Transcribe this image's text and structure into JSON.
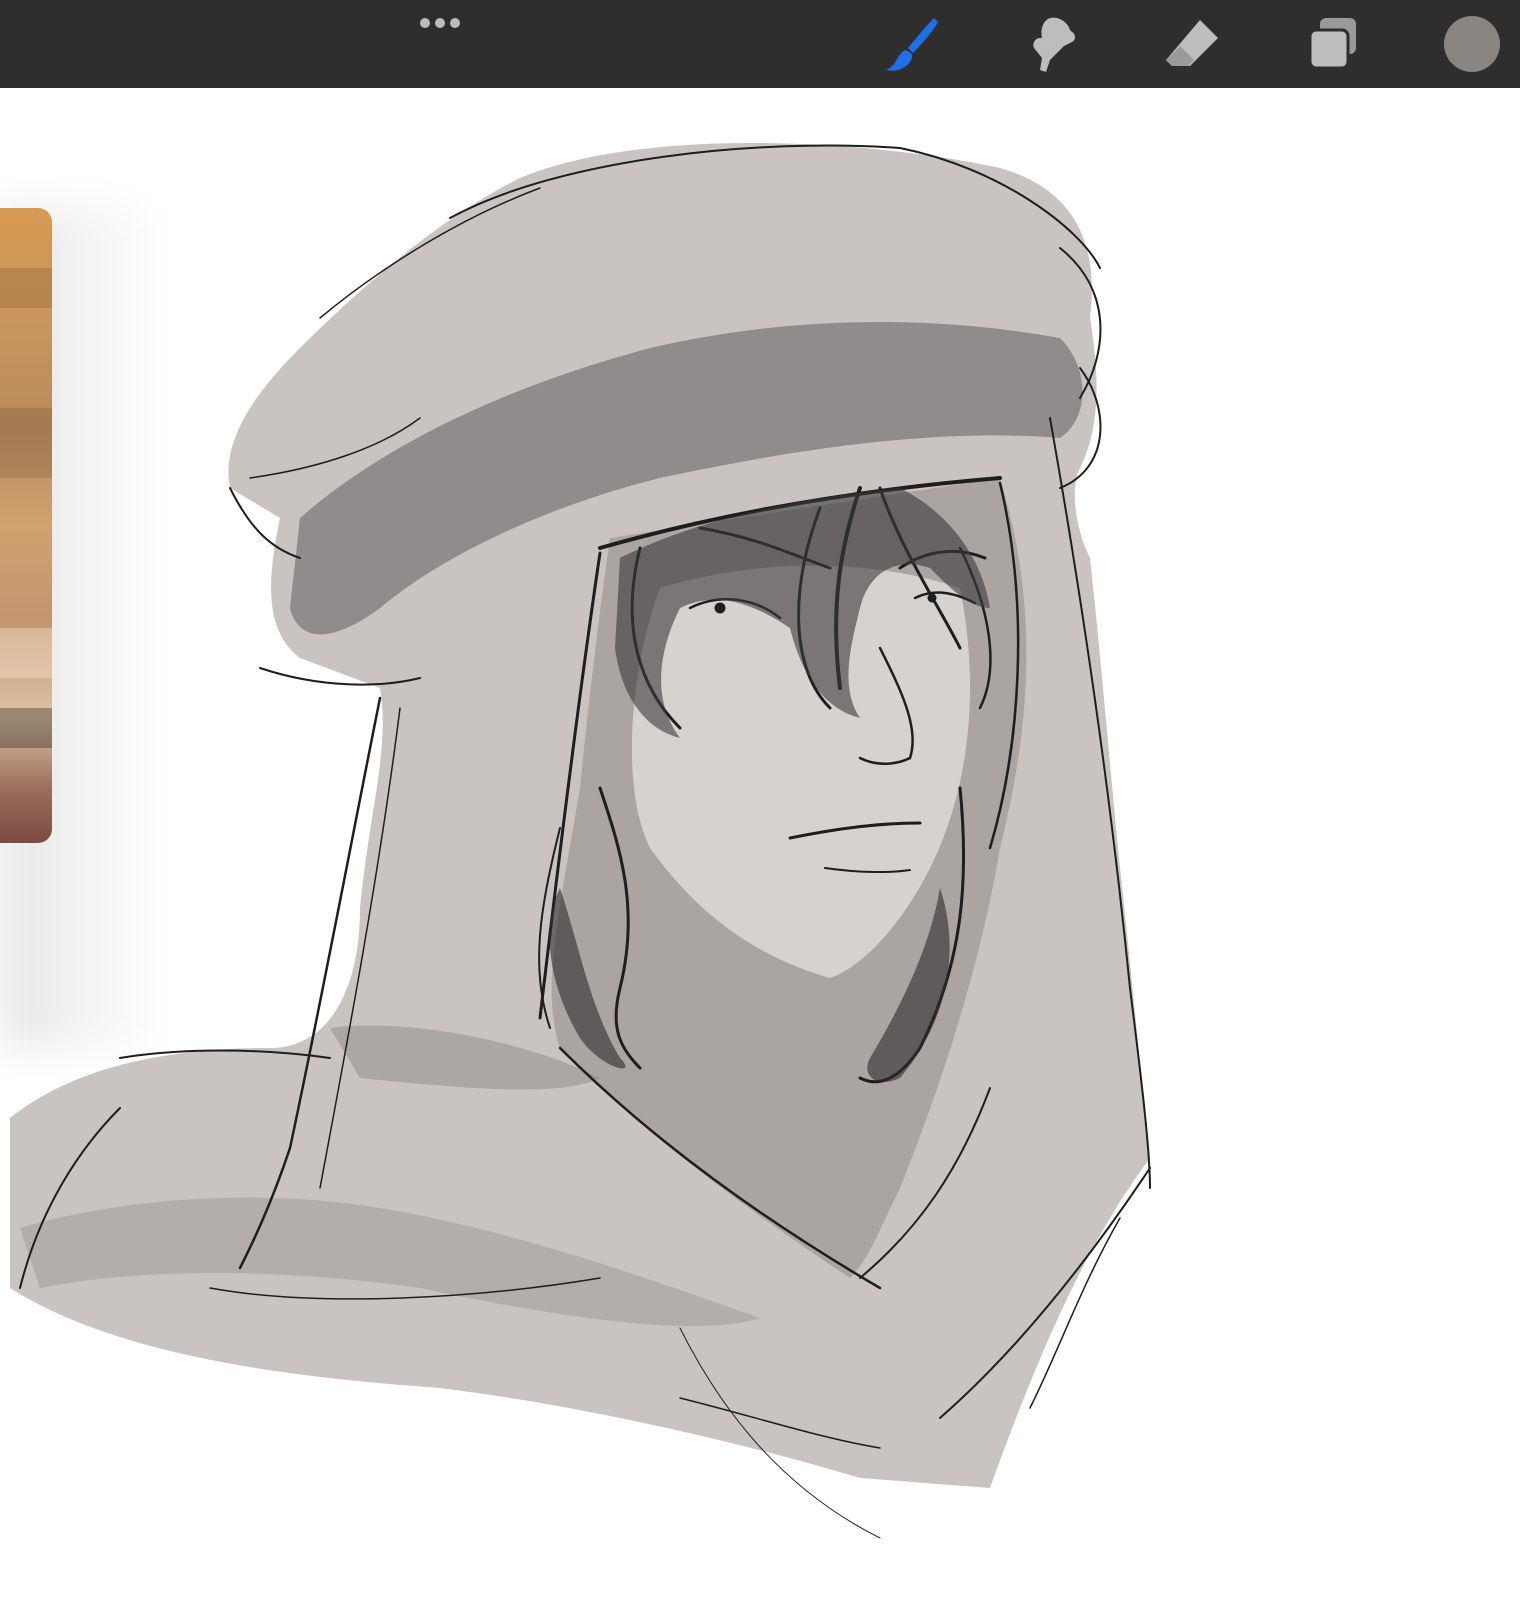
{
  "toolbar": {
    "more_icon": "more-dots-icon",
    "tools": [
      {
        "name": "brush",
        "icon": "brush-icon",
        "active": true
      },
      {
        "name": "smudge",
        "icon": "smudge-icon",
        "active": false
      },
      {
        "name": "eraser",
        "icon": "eraser-icon",
        "active": false
      },
      {
        "name": "layers",
        "icon": "layers-icon",
        "active": false
      }
    ],
    "current_color": "#8a8580"
  },
  "colors": {
    "toolbar_bg": "#2e2e2e",
    "active_tool": "#1f6fe8",
    "inactive_tool": "#bdbdbd",
    "canvas_bg": "#ffffff",
    "cloth_fill": "#c9c4c2",
    "shadow_fill": "#8e8a88",
    "line": "#1e1e1e"
  },
  "canvas": {
    "reference_image": "reference-photo"
  }
}
